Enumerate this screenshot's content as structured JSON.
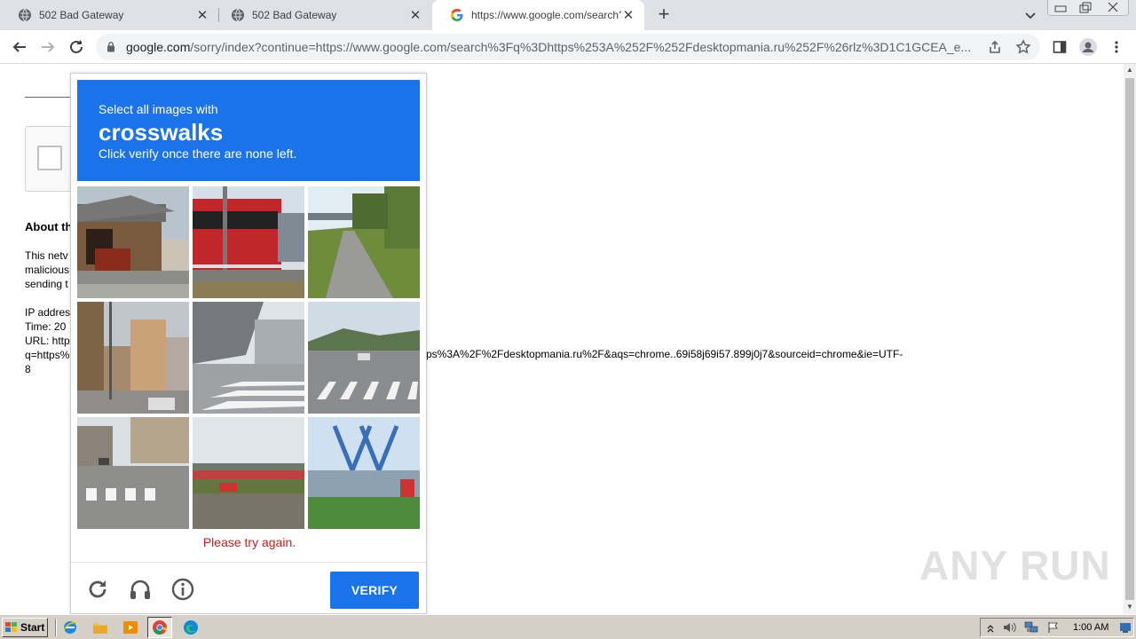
{
  "browser": {
    "tabs": [
      {
        "title": "502 Bad Gateway",
        "active": false
      },
      {
        "title": "502 Bad Gateway",
        "active": false
      },
      {
        "title": "https://www.google.com/search?q=",
        "active": true
      }
    ],
    "new_tab_label": "+",
    "url_host": "google.com",
    "url_rest": "/sorry/index?continue=https://www.google.com/search%3Fq%3Dhttps%253A%252F%252Fdesktopmania.ru%252F%26rlz%3D1C1GCEA_e..."
  },
  "page": {
    "about_heading": "About th",
    "para1": [
      "This netv",
      "malicious",
      "sending t"
    ],
    "para2": [
      "IP addres",
      "Time: 20",
      "URL: http",
      "q=https%",
      "8"
    ],
    "url_tail": "ps%3A%2F%2Fdesktopmania.ru%2F&aqs=chrome..69i58j69i57.899j0j7&sourceid=chrome&ie=UTF-"
  },
  "captcha": {
    "header_line1": "Select all images with",
    "header_keyword": "crosswalks",
    "header_line3": "Click verify once there are none left.",
    "error_text": "Please try again.",
    "verify_label": "VERIFY",
    "accent_color": "#1a73e8",
    "error_color": "#c5221f"
  },
  "watermark": "ANY RUN",
  "taskbar": {
    "start_label": "Start",
    "clock": "1:00 AM"
  }
}
